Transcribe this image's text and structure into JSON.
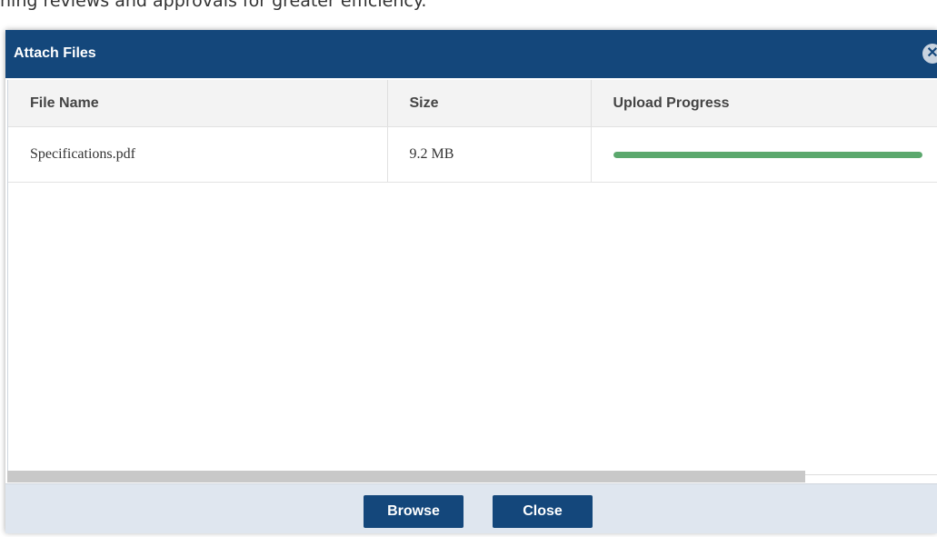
{
  "background": {
    "partial_text": "ning reviews and approvals for greater efficiency."
  },
  "dialog": {
    "title": "Attach Files",
    "close_icon": "close-circle-icon"
  },
  "table": {
    "columns": [
      "File Name",
      "Size",
      "Upload Progress"
    ],
    "rows": [
      {
        "file_name": "Specifications.pdf",
        "size": "9.2 MB",
        "progress": 1.0
      }
    ]
  },
  "footer": {
    "browse_label": "Browse",
    "close_label": "Close"
  },
  "colors": {
    "titlebar": "#14477b",
    "button": "#14477b",
    "progress": "#5ba86d",
    "footer": "#dfe6ef"
  }
}
